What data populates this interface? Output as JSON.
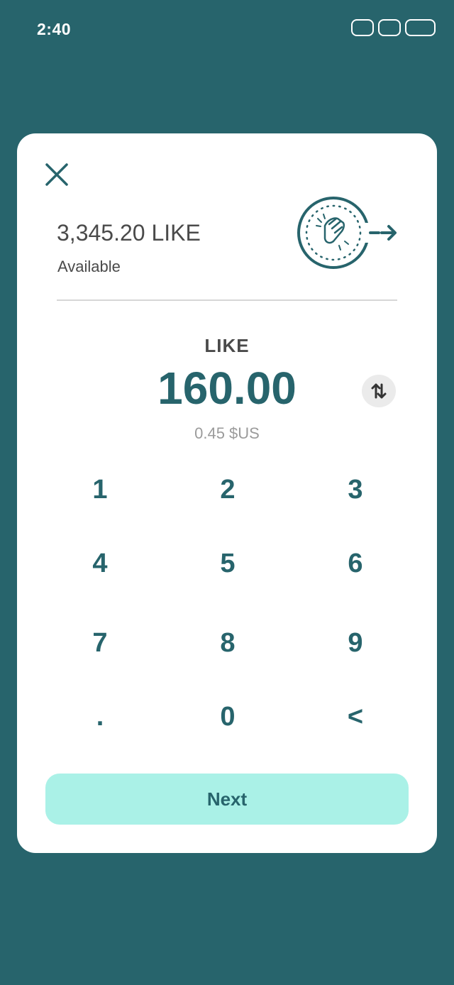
{
  "status_bar": {
    "time": "2:40"
  },
  "balance": {
    "amount": "3,345.20 LIKE",
    "label": "Available"
  },
  "amount_input": {
    "currency": "LIKE",
    "value": "160.00",
    "fiat": "0.45 $US"
  },
  "keypad": {
    "keys": [
      "1",
      "2",
      "3",
      "4",
      "5",
      "6",
      "7",
      "8",
      "9",
      ".",
      "0",
      "<"
    ]
  },
  "actions": {
    "next_label": "Next"
  },
  "colors": {
    "background": "#27646C",
    "accent": "#27646C",
    "button": "#AAF1E7"
  },
  "icons": {
    "close": "close-icon",
    "send": "clap-hands-send-icon",
    "swap": "swap-vertical-icon"
  }
}
